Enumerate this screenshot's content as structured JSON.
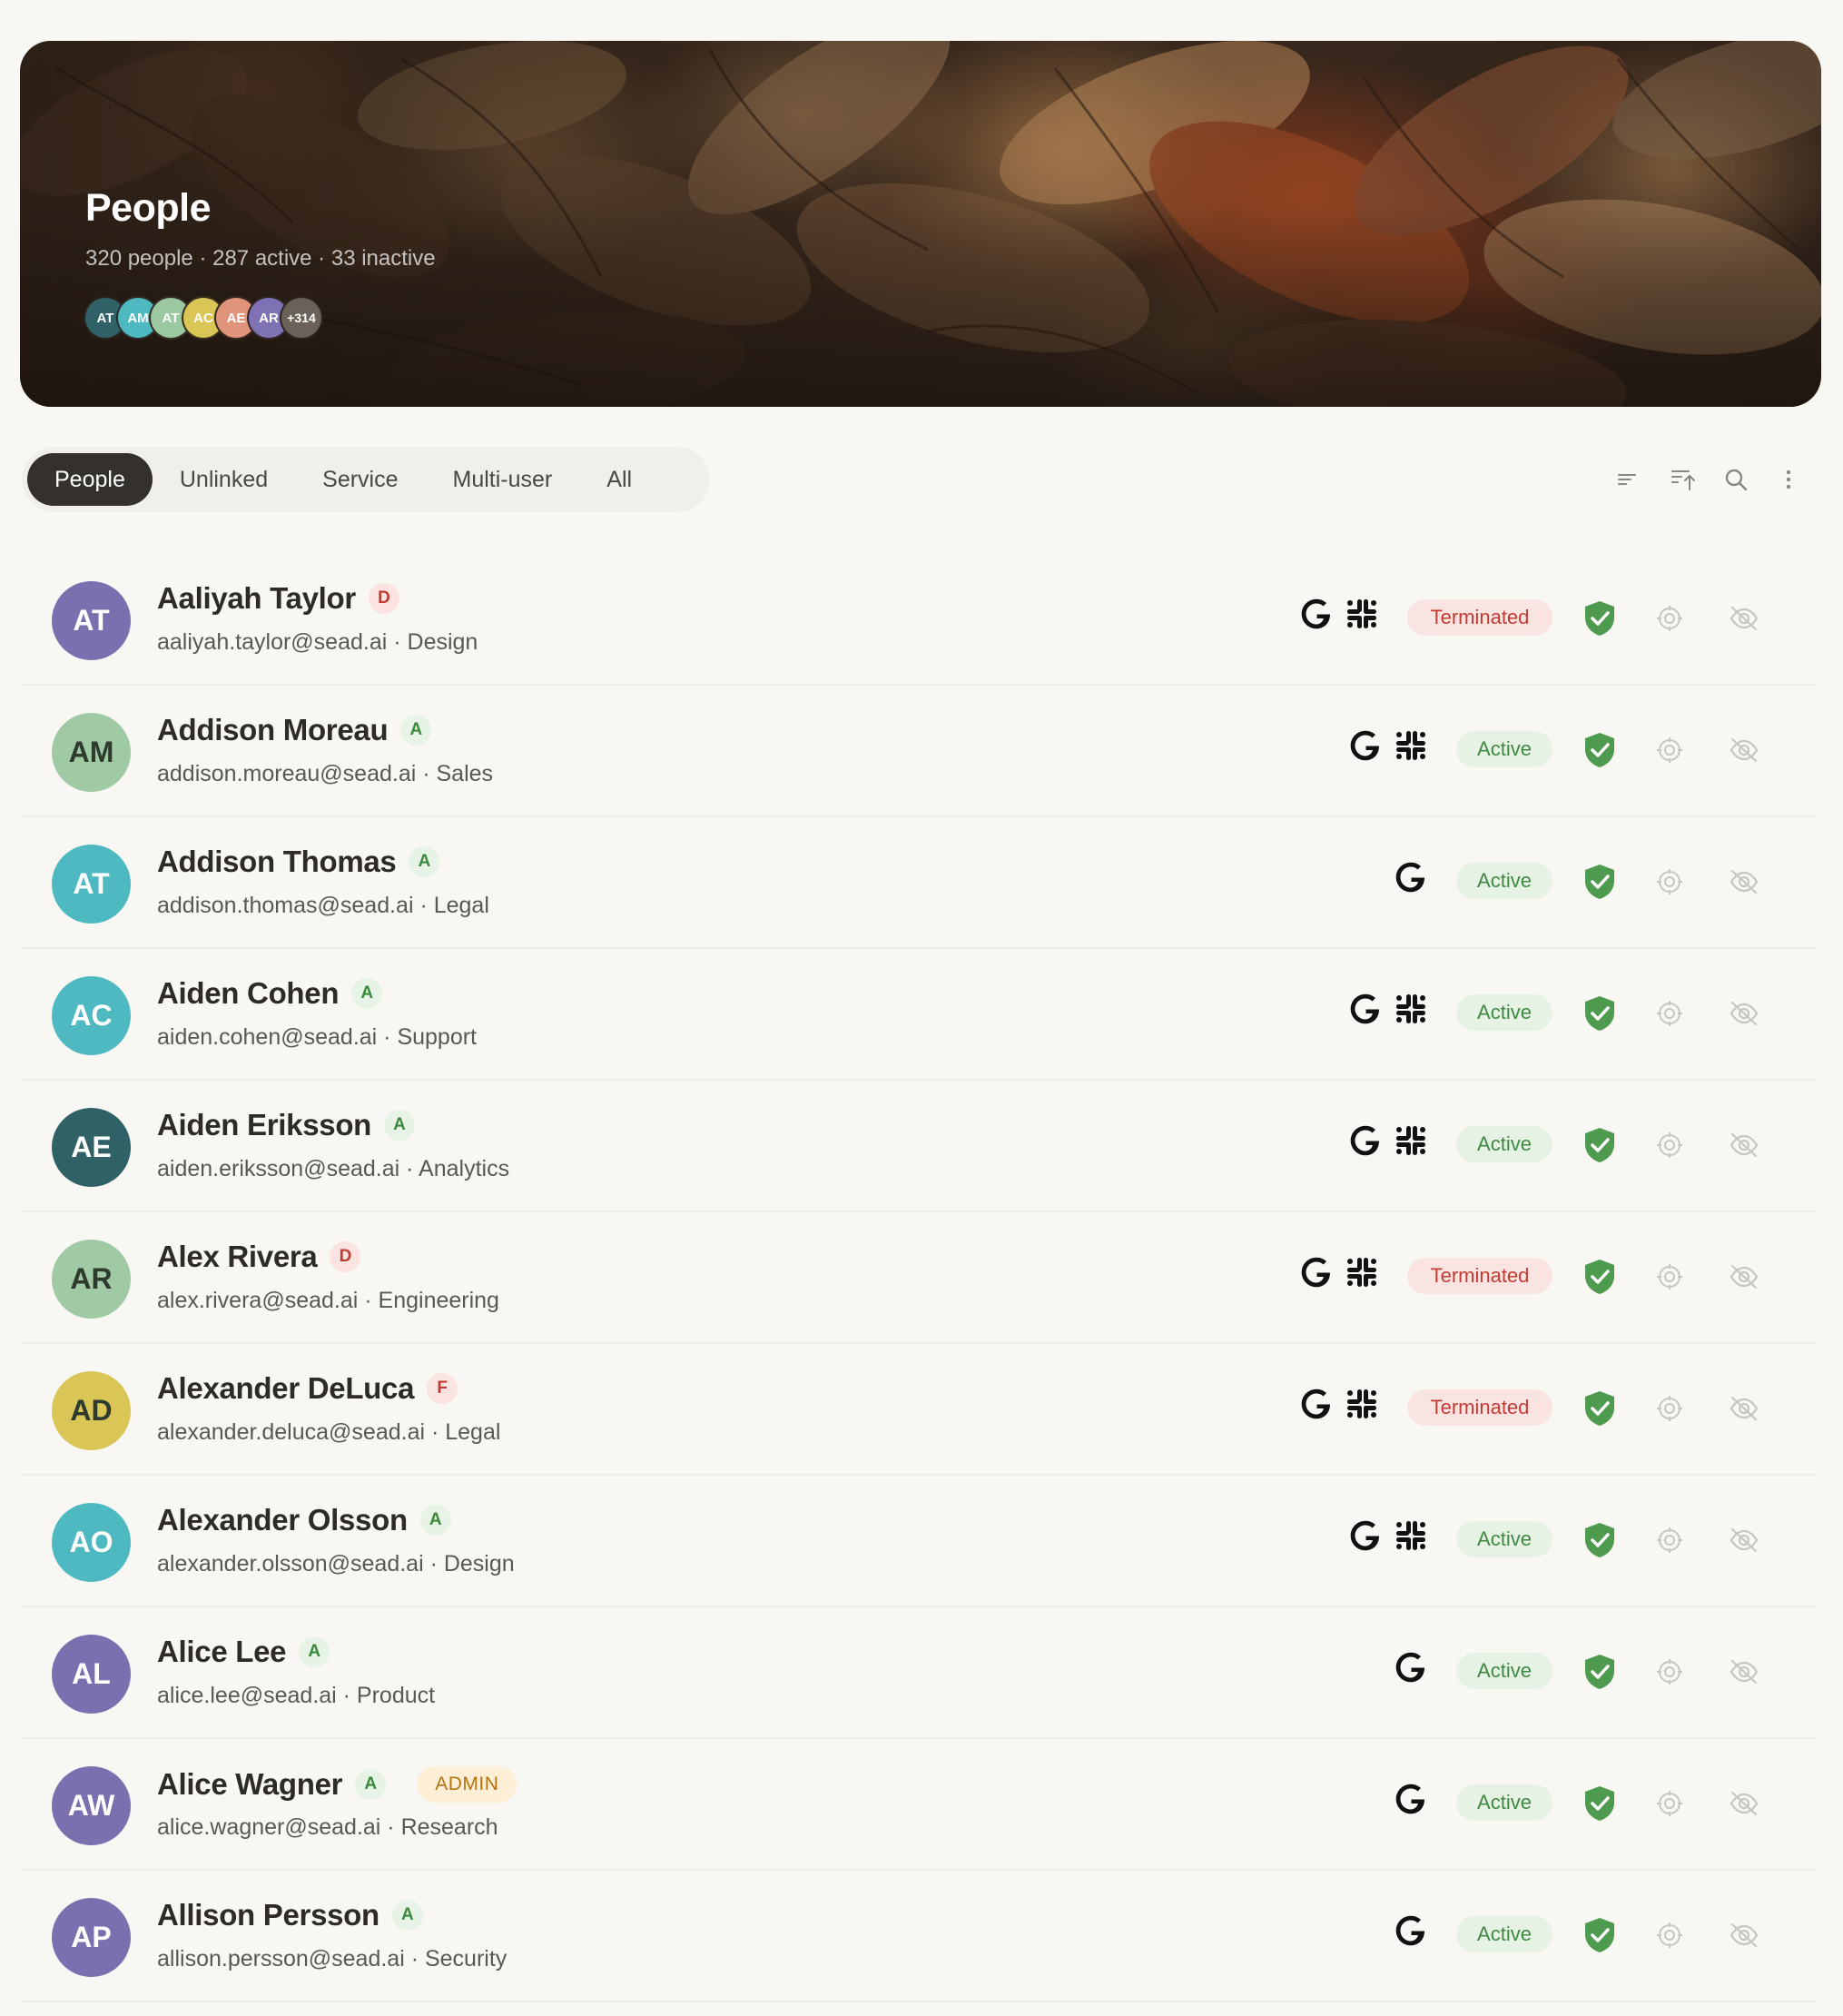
{
  "hero": {
    "title": "People",
    "subtitle": "320 people · 287 active · 33 inactive",
    "avatars": [
      {
        "initials": "AT",
        "color": "#2f6166"
      },
      {
        "initials": "AM",
        "color": "#4fb9c1"
      },
      {
        "initials": "AT",
        "color": "#9cc8a1"
      },
      {
        "initials": "AC",
        "color": "#d9c657"
      },
      {
        "initials": "AE",
        "color": "#e0957b"
      },
      {
        "initials": "AR",
        "color": "#7e72b5"
      }
    ],
    "overflow_label": "+314",
    "overflow_color": "#6a6259"
  },
  "tabs": [
    {
      "label": "People",
      "active": true
    },
    {
      "label": "Unlinked",
      "active": false
    },
    {
      "label": "Service",
      "active": false
    },
    {
      "label": "Multi-user",
      "active": false
    },
    {
      "label": "All",
      "active": false
    }
  ],
  "toolbar": {
    "icons": [
      "filter-icon",
      "sort-icon",
      "search-icon",
      "more-vertical-icon"
    ]
  },
  "colors": {
    "active_bg": "#e6f2e4",
    "active_text": "#3f8a42",
    "terminated_bg": "#fae4e2",
    "terminated_text": "#c43b33",
    "shield": "#4e9a4f",
    "admin_bg": "#fcefd6",
    "admin_text": "#b57310"
  },
  "people": [
    {
      "initials": "AT",
      "avatar_color": "#7b6fb0",
      "name": "Aaliyah Taylor",
      "code": "D",
      "admin": "",
      "email_dept": "aaliyah.taylor@sead.ai · Design",
      "apps": [
        "google-icon",
        "slack-icon"
      ],
      "status": "Terminated"
    },
    {
      "initials": "AM",
      "avatar_color": "#9fcaa3",
      "dark_text": true,
      "name": "Addison Moreau",
      "code": "A",
      "admin": "",
      "email_dept": "addison.moreau@sead.ai · Sales",
      "apps": [
        "google-icon",
        "slack-icon"
      ],
      "status": "Active"
    },
    {
      "initials": "AT",
      "avatar_color": "#4fb9c1",
      "name": "Addison Thomas",
      "code": "A",
      "admin": "",
      "email_dept": "addison.thomas@sead.ai · Legal",
      "apps": [
        "google-icon"
      ],
      "status": "Active"
    },
    {
      "initials": "AC",
      "avatar_color": "#4fb9c1",
      "name": "Aiden Cohen",
      "code": "A",
      "admin": "",
      "email_dept": "aiden.cohen@sead.ai · Support",
      "apps": [
        "google-icon",
        "slack-icon"
      ],
      "status": "Active"
    },
    {
      "initials": "AE",
      "avatar_color": "#2f6166",
      "name": "Aiden Eriksson",
      "code": "A",
      "admin": "",
      "email_dept": "aiden.eriksson@sead.ai · Analytics",
      "apps": [
        "google-icon",
        "slack-icon"
      ],
      "status": "Active"
    },
    {
      "initials": "AR",
      "avatar_color": "#9fcaa3",
      "dark_text": true,
      "name": "Alex Rivera",
      "code": "D",
      "admin": "",
      "email_dept": "alex.rivera@sead.ai · Engineering",
      "apps": [
        "google-icon",
        "slack-icon"
      ],
      "status": "Terminated"
    },
    {
      "initials": "AD",
      "avatar_color": "#d9c657",
      "dark_text": true,
      "name": "Alexander DeLuca",
      "code": "F",
      "admin": "",
      "email_dept": "alexander.deluca@sead.ai · Legal",
      "apps": [
        "google-icon",
        "slack-icon"
      ],
      "status": "Terminated"
    },
    {
      "initials": "AO",
      "avatar_color": "#4fb9c1",
      "name": "Alexander Olsson",
      "code": "A",
      "admin": "",
      "email_dept": "alexander.olsson@sead.ai · Design",
      "apps": [
        "google-icon",
        "slack-icon"
      ],
      "status": "Active"
    },
    {
      "initials": "AL",
      "avatar_color": "#7b6fb0",
      "name": "Alice Lee",
      "code": "A",
      "admin": "",
      "email_dept": "alice.lee@sead.ai · Product",
      "apps": [
        "google-icon"
      ],
      "status": "Active"
    },
    {
      "initials": "AW",
      "avatar_color": "#7b6fb0",
      "name": "Alice Wagner",
      "code": "A",
      "admin": "ADMIN",
      "email_dept": "alice.wagner@sead.ai · Research",
      "apps": [
        "google-icon"
      ],
      "status": "Active"
    },
    {
      "initials": "AP",
      "avatar_color": "#7b6fb0",
      "name": "Allison Persson",
      "code": "A",
      "admin": "",
      "email_dept": "allison.persson@sead.ai · Security",
      "apps": [
        "google-icon"
      ],
      "status": "Active"
    }
  ]
}
